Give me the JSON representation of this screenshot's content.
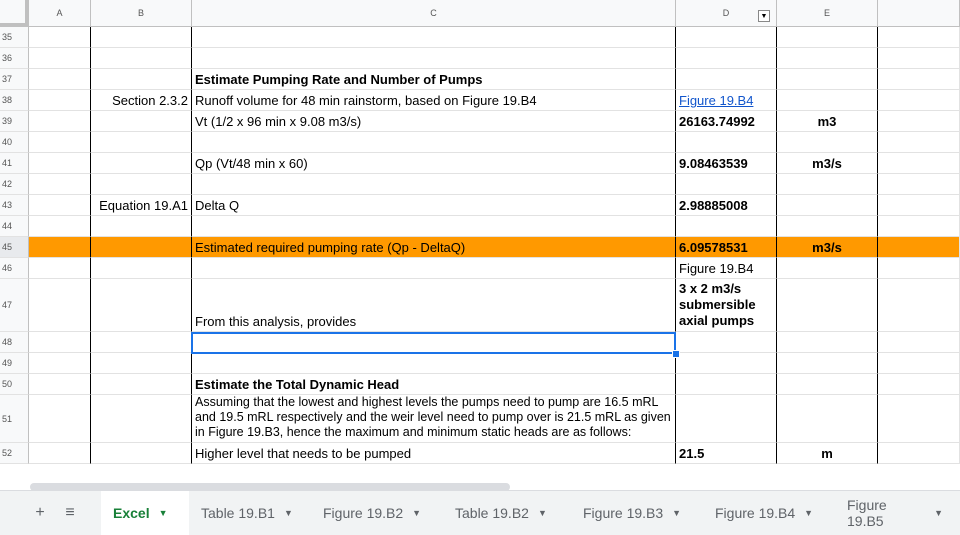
{
  "columns": [
    "A",
    "B",
    "C",
    "D",
    "E"
  ],
  "rows": [
    {
      "num": "35",
      "b": "",
      "c": "",
      "d": "",
      "e": ""
    },
    {
      "num": "36",
      "b": "",
      "c": "",
      "d": "",
      "e": ""
    },
    {
      "num": "37",
      "b": "",
      "c": "Estimate Pumping Rate and Number of Pumps",
      "d": "",
      "e": ""
    },
    {
      "num": "38",
      "b": "Section 2.3.2",
      "c": "Runoff volume for 48 min rainstorm, based on Figure 19.B4",
      "d": "Figure 19.B4",
      "e": ""
    },
    {
      "num": "39",
      "b": "",
      "c": "Vt (1/2 x 96 min x 9.08 m3/s)",
      "d": "26163.74992",
      "e": "m3"
    },
    {
      "num": "40",
      "b": "",
      "c": "",
      "d": "",
      "e": ""
    },
    {
      "num": "41",
      "b": "",
      "c": "Qp (Vt/48 min x 60)",
      "d": "9.08463539",
      "e": "m3/s"
    },
    {
      "num": "42",
      "b": "",
      "c": "",
      "d": "",
      "e": ""
    },
    {
      "num": "43",
      "b": "Equation 19.A1",
      "c": "Delta Q",
      "d": "2.98885008",
      "e": ""
    },
    {
      "num": "44",
      "b": "",
      "c": "",
      "d": "",
      "e": ""
    },
    {
      "num": "45",
      "b": "",
      "c": "Estimated required pumping rate (Qp - DeltaQ)",
      "d": "6.09578531",
      "e": "m3/s"
    },
    {
      "num": "46",
      "b": "",
      "c": "",
      "d": "Figure 19.B4",
      "e": ""
    },
    {
      "num": "47",
      "b": "",
      "c": "From this analysis, provides",
      "d": "3 x 2 m3/s submersible axial pumps",
      "e": ""
    },
    {
      "num": "48",
      "b": "",
      "c": "",
      "d": "",
      "e": ""
    },
    {
      "num": "49",
      "b": "",
      "c": "",
      "d": "",
      "e": ""
    },
    {
      "num": "50",
      "b": "",
      "c": "Estimate the Total Dynamic Head",
      "d": "",
      "e": ""
    },
    {
      "num": "51",
      "b": "",
      "c": "Assuming that the lowest and highest levels the pumps need to pump are 16.5 mRL and 19.5 mRL respectively and the weir level need to pump over is 21.5 mRL as given in Figure 19.B3, hence the maximum and minimum static heads are as follows:",
      "d": "",
      "e": ""
    },
    {
      "num": "52",
      "b": "",
      "c": "Higher level that needs to be pumped",
      "d": "21.5",
      "e": "m"
    }
  ],
  "tabs": [
    "Excel",
    "Table 19.B1",
    "Figure 19.B2",
    "Table 19.B2",
    "Figure 19.B3",
    "Figure 19.B4",
    "Figure 19.B5"
  ],
  "toolbar": {
    "add_symbol": "+",
    "menu_symbol": "≡",
    "caret": "▼"
  },
  "colors": {
    "highlight": "#ff9900",
    "active_tab": "#188038",
    "selection": "#1a73e8"
  }
}
